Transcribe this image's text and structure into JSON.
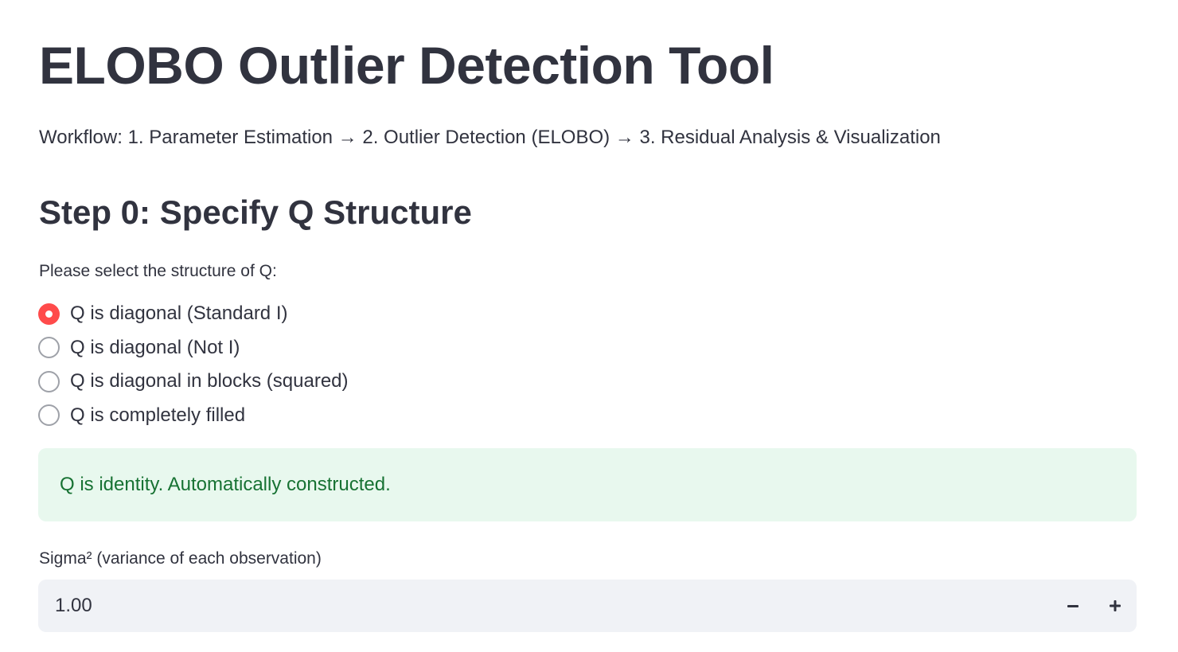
{
  "header": {
    "title": "ELOBO Outlier Detection Tool",
    "workflow": "Workflow: 1. Parameter Estimation → 2. Outlier Detection (ELOBO) → 3. Residual Analysis & Visualization"
  },
  "step0": {
    "heading": "Step 0: Specify Q Structure",
    "radio_label": "Please select the structure of Q:",
    "options": [
      {
        "label": "Q is diagonal (Standard I)",
        "selected": true
      },
      {
        "label": "Q is diagonal (Not I)",
        "selected": false
      },
      {
        "label": "Q is diagonal in blocks (squared)",
        "selected": false
      },
      {
        "label": "Q is completely filled",
        "selected": false
      }
    ],
    "info_message": "Q is identity. Automatically constructed."
  },
  "sigma": {
    "label": "Sigma² (variance of each observation)",
    "value": "1.00",
    "decrement_icon": "minus-icon",
    "increment_icon": "plus-icon"
  },
  "colors": {
    "accent": "#ff4b4b",
    "text": "#31333f",
    "success_bg": "#e8f8ee",
    "success_text": "#177233",
    "input_bg": "#f0f2f6"
  }
}
